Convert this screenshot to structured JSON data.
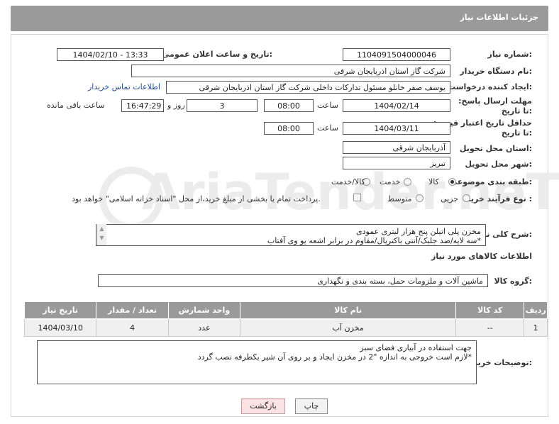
{
  "header": {
    "title": "جزئیات اطلاعات نیاز"
  },
  "labels": {
    "need_number": "شماره نیاز:",
    "announce_datetime": "تاریخ و ساعت اعلان عمومی:",
    "buyer_org": "نام دستگاه خریدار:",
    "requester": "ایجاد کننده درخواست:",
    "reply_deadline": "مهلت ارسال پاسخ: تا تاریخ:",
    "price_validity": "حداقل تاریخ اعتبار قیمت: تا تاریخ:",
    "delivery_province": "استان محل تحویل:",
    "delivery_city": "شهر محل تحویل:",
    "category": "طبقه بندی موضوعی:",
    "purchase_type": "نوع فرآیند خرید :",
    "hour": "ساعت",
    "day_and": "روز و",
    "remaining": "ساعت باقی مانده",
    "description": "شرح کلی نیاز:",
    "goods_info": "اطلاعات کالاهای مورد نیاز",
    "goods_group": "گروه کالا:",
    "buyer_notes": "توضیحات خریدار:"
  },
  "fields": {
    "need_number": "1104091504000046",
    "announce_datetime": "1404/02/10 - 13:33",
    "buyer_org": "شرکت گاز استان اذربایجان شرقی",
    "requester": "یوسف صفر خانلو  مسئول تدارکات داخلی  شرکت گاز استان اذربایجان شرقی",
    "contact_link": "اطلاعات تماس خریدار",
    "reply_date": "1404/02/14",
    "reply_time": "08:00",
    "reply_days": "3",
    "reply_remaining": "16:47:29",
    "validity_date": "1404/03/11",
    "validity_time": "08:00",
    "province": "آذربایجان شرقی",
    "city": "تبریز"
  },
  "category_options": [
    "کالا",
    "خدمت",
    "کالا/خدمت"
  ],
  "category_selected": "کالا",
  "purchase_options": [
    "جزیی",
    "متوسط"
  ],
  "purchase_note": "پرداخت تمام یا بخشی از مبلغ خرید،از محل \"اسناد خزانه اسلامی\" خواهد بود.",
  "description_lines": [
    "مخزن پلی اتیلن پنج هزار لیتری عمودی",
    "*سه لایه/ضد جلبک/آنتی باکتریال/مقاوم در برابر اشعه یو وی آفتاب"
  ],
  "goods_group_value": "ماشین آلات و ملزومات حمل، بسته بندی و نگهداری",
  "table": {
    "headers": [
      "ردیف",
      "کد کالا",
      "نام کالا",
      "واحد شمارش",
      "تعداد / مقدار",
      "تاریخ نیاز"
    ],
    "rows": [
      [
        "1",
        "--",
        "مخزن آب",
        "عدد",
        "4",
        "1404/03/10"
      ]
    ]
  },
  "notes_lines": [
    "جهت استفاده در آبیاری فضای سبز",
    "*لازم است خروجی به اندازه \"2 در مخزن ایجاد و بر روی آن شیر یکطرفه نصب گردد"
  ],
  "buttons": {
    "print": "چاپ",
    "back": "بازگشت"
  },
  "watermark": "AriaTender.neT"
}
